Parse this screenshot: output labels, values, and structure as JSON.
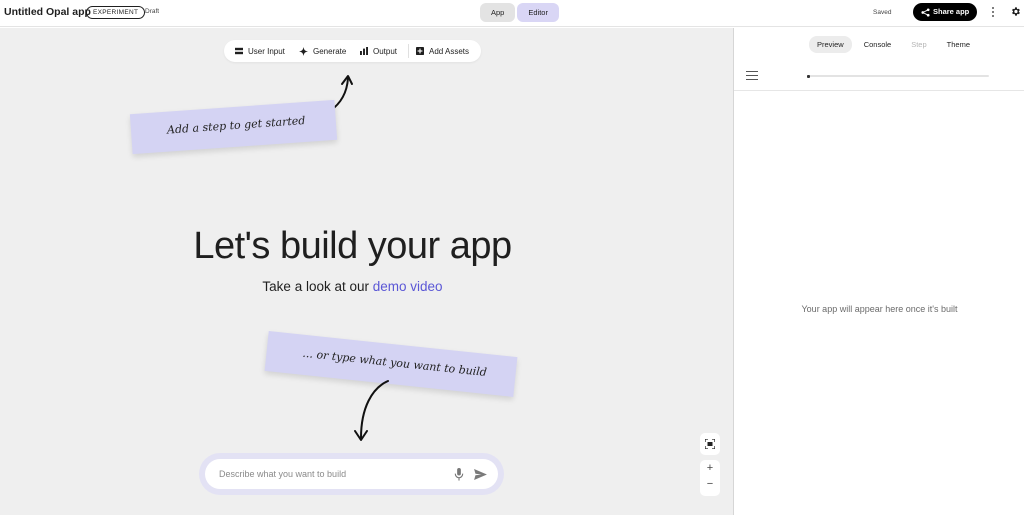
{
  "header": {
    "app_title": "Untitled Opal app",
    "badge": "EXPERIMENT",
    "status": "Draft",
    "toggle": [
      "App",
      "Editor"
    ],
    "saved": "Saved",
    "share_label": "Share app"
  },
  "toolbar": {
    "items": [
      {
        "label": "User Input",
        "icon": "user-input-icon"
      },
      {
        "label": "Generate",
        "icon": "sparkle-icon"
      },
      {
        "label": "Output",
        "icon": "bar-chart-icon"
      },
      {
        "label": "Add Assets",
        "icon": "add-box-icon"
      }
    ]
  },
  "notes": {
    "step": "Add a step to get started",
    "type": "... or type what you want to build"
  },
  "main": {
    "heading": "Let's build your app",
    "subline_prefix": "Take a look at our",
    "subline_link": "demo video"
  },
  "prompt": {
    "placeholder": "Describe what you want to build"
  },
  "panel": {
    "tabs": [
      {
        "label": "Preview",
        "state": "active"
      },
      {
        "label": "Console",
        "state": "normal"
      },
      {
        "label": "Step",
        "state": "disabled"
      },
      {
        "label": "Theme",
        "state": "normal"
      }
    ],
    "empty_message": "Your app will appear here once it's built"
  },
  "colors": {
    "accent": "#5b57d6",
    "note_bg": "#d4d3f3",
    "canvas_bg": "#efefef",
    "editor_toggle": "#d9d6f5"
  }
}
